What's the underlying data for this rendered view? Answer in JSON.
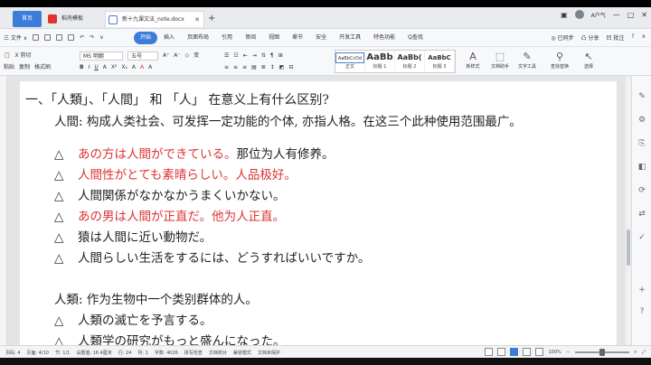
{
  "tabs": {
    "home": "首页",
    "wps": "稻壳模板",
    "doc": "新十九课文法_note.docx",
    "add": "+"
  },
  "window": {
    "account": "A户气",
    "controls": [
      "□",
      "⊟",
      "—",
      "□",
      "✕"
    ]
  },
  "menubar": {
    "file": "三 文件 ∨",
    "tabs": [
      "开始",
      "插入",
      "页面布局",
      "引用",
      "审阅",
      "视图",
      "章节",
      "安全",
      "开发工具",
      "特色功能",
      "Q查找"
    ],
    "active_tab": "开始",
    "right": [
      "◎ 已同步",
      "凸 分享",
      "凹 批注",
      "?",
      "∧"
    ]
  },
  "ribbon": {
    "paste": "粘贴",
    "cut": "X 剪切",
    "copy": "复制",
    "format_painter": "格式刷",
    "font_name": "MS 明朝",
    "font_size": "五号",
    "styles": [
      {
        "sample": "AaBbCcDd",
        "name": "正文"
      },
      {
        "sample": "AaBb",
        "name": "标题 1"
      },
      {
        "sample": "AaBb(",
        "name": "标题 2"
      },
      {
        "sample": "AaBbC",
        "name": "标题 3"
      }
    ],
    "tools": [
      {
        "icon": "A",
        "label": "新样式"
      },
      {
        "icon": "⬚",
        "label": "文档助手"
      },
      {
        "icon": "✎",
        "label": "文字工具"
      },
      {
        "icon": "⚲",
        "label": "查找替换"
      },
      {
        "icon": "↖",
        "label": "选择"
      }
    ]
  },
  "document": {
    "heading": "一、「人類」、「人間」 和 「人」 在意义上有什么区别?",
    "definition": "人間: 构成人类社会、可发挥一定功能的个体, 亦指人格。在这三个此种使用范围最广。",
    "examples": [
      {
        "jp": "あの方は人間ができている。",
        "zh": "那位为人有修养。",
        "red_jp": true,
        "red_zh": false
      },
      {
        "jp": "人間性がとても素晴らしい。",
        "zh": "人品极好。",
        "red_jp": true,
        "red_zh": true
      },
      {
        "jp": "人間関係がなかなかうまくいかない。",
        "zh": "",
        "red_jp": false,
        "red_zh": false
      },
      {
        "jp": "あの男は人間が正直だ。",
        "zh": "他为人正直。",
        "red_jp": true,
        "red_zh": true
      },
      {
        "jp": "猿は人間に近い動物だ。",
        "zh": "",
        "red_jp": false,
        "red_zh": false
      },
      {
        "jp": "人間らしい生活をするには、どうすればいいですか。",
        "zh": "",
        "red_jp": false,
        "red_zh": false
      }
    ],
    "triangle": "△",
    "subheading": "人類: 作为生物中一个类别群体的人。",
    "examples2": [
      {
        "jp": "人類の滅亡を予言する。"
      },
      {
        "jp": "人類学の研究がもっと盛んになった。"
      }
    ]
  },
  "status": {
    "items": [
      "页码: 4",
      "页面: 4/10",
      "节: 1/1",
      "设置值: 16.4厘米",
      "行: 24",
      "列: 1",
      "字数: 4026",
      "拼写检查",
      "文档校对",
      "兼容模式",
      "文档未保护"
    ],
    "zoom": "100%"
  }
}
